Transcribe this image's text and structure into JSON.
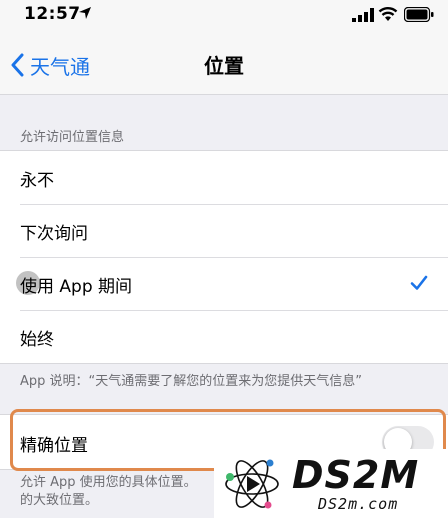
{
  "status": {
    "time": "12:57"
  },
  "nav": {
    "back_label": "天气通",
    "title": "位置"
  },
  "section": {
    "header": "允许访问位置信息"
  },
  "options": [
    {
      "label": "永不",
      "selected": false
    },
    {
      "label": "下次询问",
      "selected": false
    },
    {
      "label": "使用 App 期间",
      "selected": true
    },
    {
      "label": "始终",
      "selected": false
    }
  ],
  "app_note": "App 说明：“天气通需要了解您的位置来为您提供天气信息”",
  "precise": {
    "label": "精确位置",
    "enabled": false
  },
  "precise_note": "允许 App 使用您的具体位置。…的大致位置。",
  "precise_note_lines": [
    "允许 App 使用您的具体位置。",
    "的大致位置。"
  ],
  "watermark": {
    "brand": "DS2M",
    "url": "DS2m.com"
  },
  "colors": {
    "accent": "#1a73e8",
    "highlight": "#e0894c",
    "background": "#efeff4"
  }
}
